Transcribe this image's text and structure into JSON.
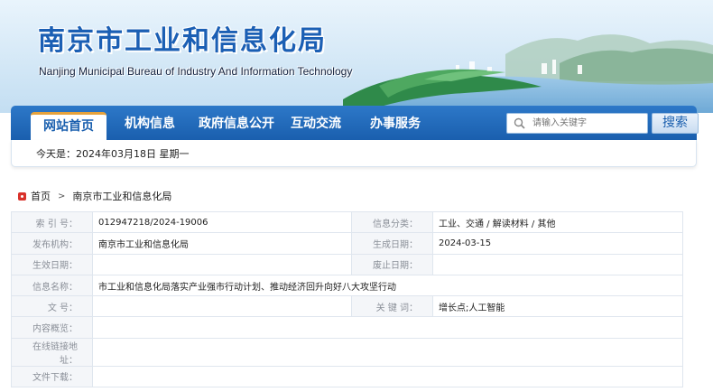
{
  "site": {
    "title": "南京市工业和信息化局",
    "subtitle": "Nanjing Municipal Bureau of Industry And Information Technology"
  },
  "nav": {
    "items": [
      {
        "label": "网站首页",
        "active": true
      },
      {
        "label": "机构信息",
        "active": false
      },
      {
        "label": "政府信息公开",
        "active": false
      },
      {
        "label": "互动交流",
        "active": false
      },
      {
        "label": "办事服务",
        "active": false
      }
    ],
    "search_placeholder": "请输入关键字",
    "search_button": "搜索"
  },
  "datebar": {
    "text": "今天是：2024年03月18日  星期一"
  },
  "breadcrumb": {
    "home": "首页",
    "separator": ">",
    "current": "南京市工业和信息化局"
  },
  "meta": {
    "index_label": "索 引 号：",
    "index_value": "012947218/2024-19006",
    "category_label": "信息分类：",
    "category_value": "工业、交通 / 解读材料 / 其他",
    "publisher_label": "发布机构：",
    "publisher_value": "南京市工业和信息化局",
    "created_label": "生成日期：",
    "created_value": "2024-03-15",
    "effective_label": "生效日期：",
    "effective_value": "",
    "repeal_label": "废止日期：",
    "repeal_value": "",
    "name_label": "信息名称：",
    "name_value": "市工业和信息化局落实产业强市行动计划、推动经济回升向好八大攻坚行动",
    "docno_label": "文    号：",
    "docno_value": "",
    "keywords_label": "关 键 词：",
    "keywords_value": "增长点;人工智能",
    "summary_label": "内容概览：",
    "summary_value": "",
    "link_label": "在线链接地址：",
    "link_value": "",
    "download_label": "文件下载：",
    "download_value": ""
  },
  "colors": {
    "nav_blue": "#1a5fae",
    "title_blue": "#1b5fb4",
    "accent_orange": "#e6a23c",
    "home_red": "#d9322b"
  }
}
